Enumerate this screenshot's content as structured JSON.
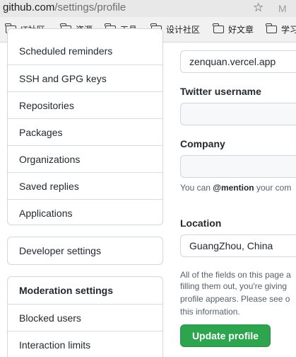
{
  "browser": {
    "url_host": "github.com",
    "url_path": "/settings/profile",
    "star_icon": "☆",
    "extension_icon": "M"
  },
  "bookmarks": [
    "IT社区",
    "资源",
    "工具",
    "设计社区",
    "好文章",
    "学习"
  ],
  "sidebar": {
    "items_top": [
      "Scheduled reminders",
      "SSH and GPG keys",
      "Repositories",
      "Packages",
      "Organizations",
      "Saved replies",
      "Applications"
    ],
    "developer_settings": "Developer settings",
    "moderation_heading": "Moderation settings",
    "moderation_items": [
      "Blocked users",
      "Interaction limits"
    ]
  },
  "form": {
    "url_value": "zenquan.vercel.app",
    "twitter_label": "Twitter username",
    "twitter_value": "",
    "company_label": "Company",
    "company_value": "",
    "company_note_prefix": "You can ",
    "company_note_mention": "@mention",
    "company_note_suffix": " your com",
    "location_label": "Location",
    "location_value": "GuangZhou, China",
    "privacy_note_lines": [
      "All of the fields on this page a",
      "filling them out, you're giving",
      "profile appears. Please see o",
      "this information."
    ],
    "update_button": "Update profile"
  }
}
